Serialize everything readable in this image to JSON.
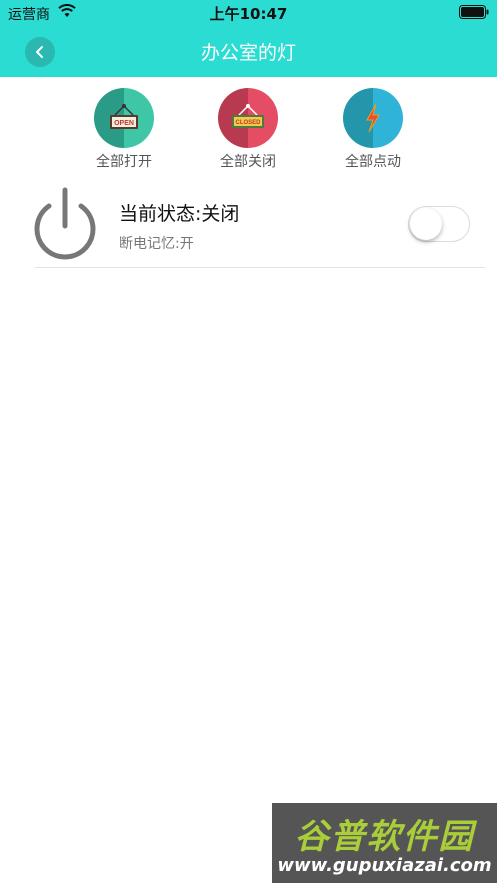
{
  "status_bar": {
    "carrier": "运营商",
    "time": "上午10:47"
  },
  "nav": {
    "title": "办公室的灯",
    "back_icon": "chevron-left-icon"
  },
  "actions": [
    {
      "label": "全部打开",
      "sign_text": "OPEN",
      "color_left": "#2a9b86",
      "color_right": "#3ec6a7"
    },
    {
      "label": "全部关闭",
      "sign_text": "CLOSED",
      "color_left": "#b73a50",
      "color_right": "#e44d63"
    },
    {
      "label": "全部点动",
      "sign_text": "",
      "color_left": "#2396ab",
      "color_right": "#2fb4d8"
    }
  ],
  "device": {
    "status": "当前状态:关闭",
    "memory": "断电记忆:开",
    "switch_on": false
  },
  "watermark": {
    "title": "谷普软件园",
    "url": "www.gupuxiazai.com"
  },
  "colors": {
    "accent": "#2adcd2"
  }
}
